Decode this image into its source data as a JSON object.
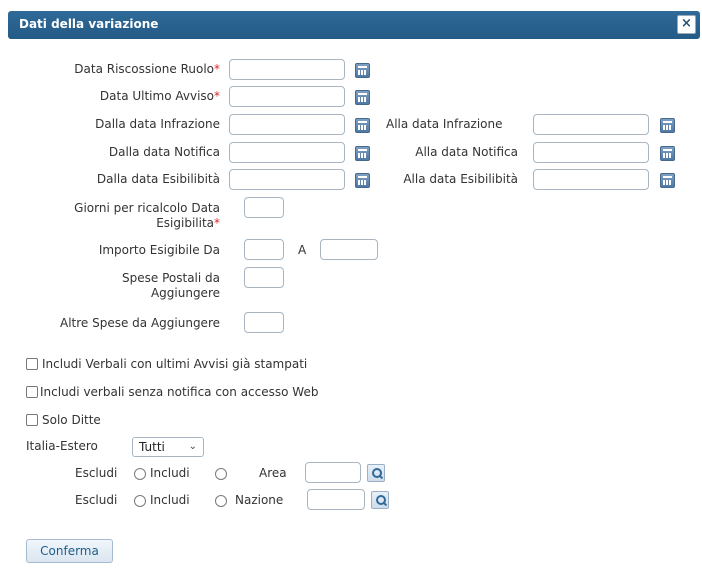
{
  "dialog": {
    "title": "Dati della variazione",
    "close_icon": "close-icon"
  },
  "fields": {
    "data_riscossione_ruolo": "Data Riscossione Ruolo",
    "data_ultimo_avviso": "Data Ultimo Avviso",
    "dalla_data_infrazione": "Dalla data Infrazione",
    "alla_data_infrazione": "Alla data Infrazione",
    "dalla_data_notifica": "Dalla data Notifica",
    "alla_data_notifica": "Alla data Notifica",
    "dalla_data_esibilita": "Dalla data Esibilibità",
    "alla_data_esibilita": "Alla data Esibilibità",
    "giorni_line1": "Giorni per ricalcolo Data",
    "giorni_line2": "Esigibilita",
    "importo_da": "Importo Esigibile Da",
    "importo_a": "A",
    "spese_line1": "Spese Postali da",
    "spese_line2": "Aggiungere",
    "altre_spese": "Altre Spese da Aggiungere",
    "required_mark": "*"
  },
  "checkboxes": {
    "includi_verbali": "Includi Verbali con ultimi Avvisi già stampati",
    "senza_notifica": "Includi verbali senza notifica con accesso Web",
    "solo_ditte": "Solo Ditte"
  },
  "italia_estero": {
    "label": "Italia-Estero",
    "selected": "Tutti"
  },
  "filters": {
    "escludi": "Escludi",
    "includi": "Includi",
    "area": "Area",
    "nazione": "Nazione"
  },
  "actions": {
    "confirm": "Conferma"
  },
  "colors": {
    "titlebar": "#2f6a98",
    "required": "#d8262c",
    "accent": "#1f5d8b"
  }
}
